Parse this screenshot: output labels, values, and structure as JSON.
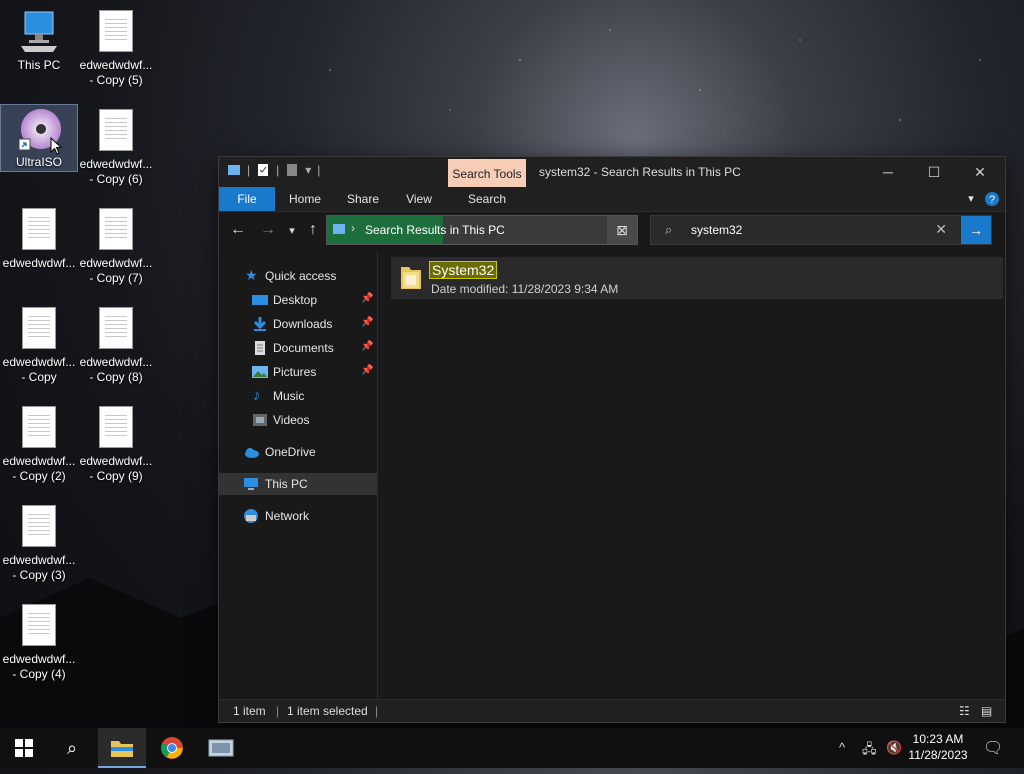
{
  "desktop": {
    "icons": [
      {
        "label": "This PC"
      },
      {
        "label": "edwedwdwf...\n- Copy (5)"
      },
      {
        "label": "UltraISO"
      },
      {
        "label": "edwedwdwf...\n- Copy (6)"
      },
      {
        "label": "edwedwdwf..."
      },
      {
        "label": "edwedwdwf...\n- Copy (7)"
      },
      {
        "label": "edwedwdwf...\n- Copy"
      },
      {
        "label": "edwedwdwf...\n- Copy (8)"
      },
      {
        "label": "edwedwdwf...\n- Copy (2)"
      },
      {
        "label": "edwedwdwf...\n- Copy (9)"
      },
      {
        "label": "edwedwdwf...\n- Copy (3)"
      },
      {
        "label": "edwedwdwf...\n- Copy (4)"
      }
    ]
  },
  "window": {
    "contextual_tab": "Search Tools",
    "title": "system32 - Search Results in This PC",
    "ribbon_tabs": [
      "File",
      "Home",
      "Share",
      "View",
      "Search"
    ],
    "address": {
      "text": "Search Results in This PC"
    },
    "search": {
      "value": "system32"
    },
    "nav": {
      "quick_access": "Quick access",
      "items": [
        {
          "label": "Desktop",
          "icon": "desktop-icon"
        },
        {
          "label": "Downloads",
          "icon": "download-icon"
        },
        {
          "label": "Documents",
          "icon": "documents-icon"
        },
        {
          "label": "Pictures",
          "icon": "pictures-icon"
        },
        {
          "label": "Music",
          "icon": "music-icon"
        },
        {
          "label": "Videos",
          "icon": "videos-icon"
        }
      ],
      "onedrive": "OneDrive",
      "this_pc": "This PC",
      "network": "Network"
    },
    "result": {
      "name": "System32",
      "date_label": "Date modified:",
      "date_value": "11/28/2023 9:34 AM"
    },
    "status": {
      "count": "1 item",
      "selected": "1 item selected"
    }
  },
  "taskbar": {
    "time": "10:23 AM",
    "date": "11/28/2023"
  },
  "colors": {
    "accent": "#1979ca",
    "contextual_tab": "#f7cdb5",
    "address_highlight": "#1c6e3d"
  }
}
